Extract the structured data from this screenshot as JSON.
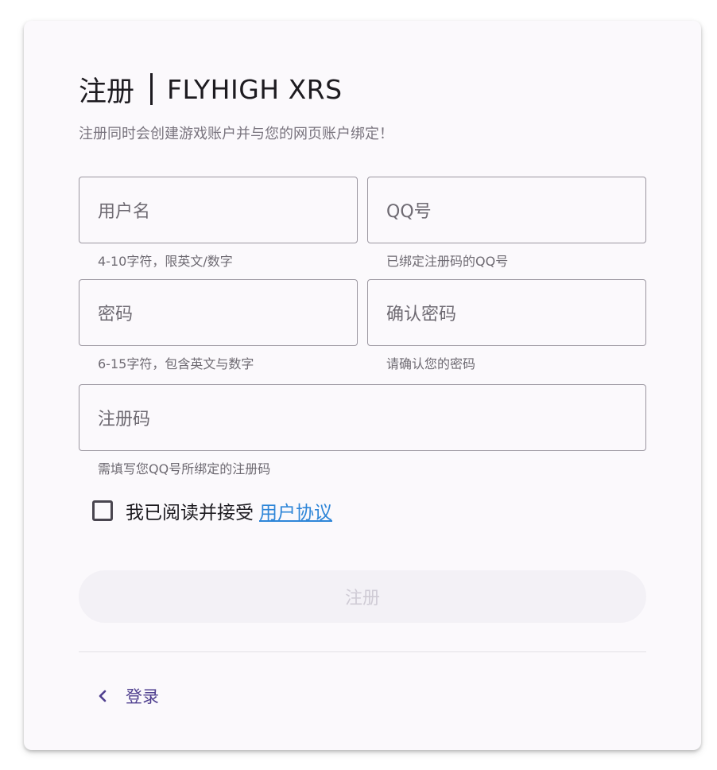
{
  "header": {
    "title": "注册",
    "app_name": "FLYHIGH XRS",
    "subtitle": "注册同时会创建游戏账户并与您的网页账户绑定！"
  },
  "form": {
    "username": {
      "placeholder": "用户名",
      "hint": "4-10字符，限英文/数字"
    },
    "qq": {
      "placeholder": "QQ号",
      "hint": "已绑定注册码的QQ号"
    },
    "password": {
      "placeholder": "密码",
      "hint": "6-15字符，包含英文与数字"
    },
    "confirm_password": {
      "placeholder": "确认密码",
      "hint": "请确认您的密码"
    },
    "reg_code": {
      "placeholder": "注册码",
      "hint": "需填写您QQ号所绑定的注册码"
    },
    "agree": {
      "text": "我已阅读并接受",
      "link_label": "用户协议",
      "checked": false
    },
    "submit_label": "注册"
  },
  "footer": {
    "back_label": "登录",
    "back_icon": "chevron-left-icon"
  },
  "colors": {
    "card_bg": "#fbf9fc",
    "link": "#2f86d8",
    "back_text": "#4f3f8f",
    "submit_disabled_bg": "#f3f1f6",
    "submit_disabled_text": "#cfcbd5"
  }
}
